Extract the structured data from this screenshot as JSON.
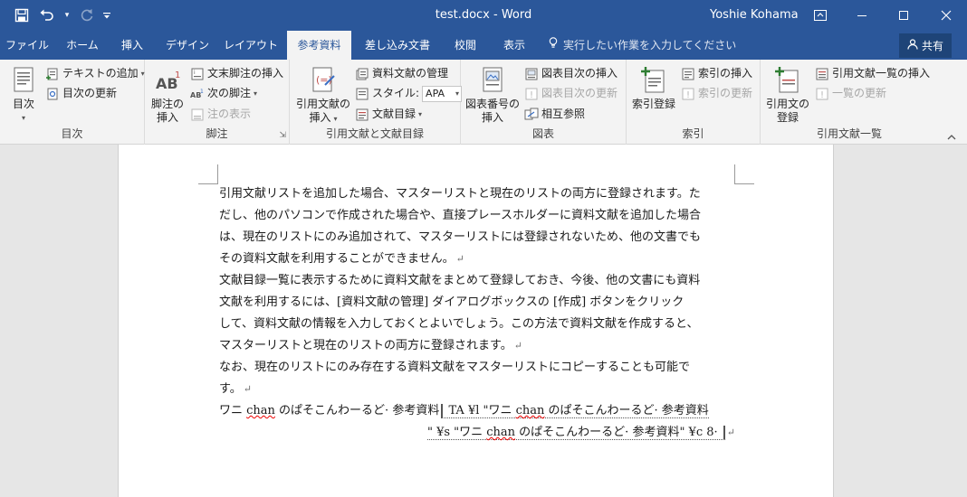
{
  "title_bar": {
    "doc_title": "test.docx - Word",
    "user": "Yoshie Kohama",
    "qat": {
      "save_icon": "save-icon",
      "undo_icon": "undo-icon",
      "redo_icon": "redo-icon",
      "customize_icon": "customize-qat-icon"
    }
  },
  "tabs": [
    {
      "label": "ファイル",
      "active": false
    },
    {
      "label": "ホーム",
      "active": false
    },
    {
      "label": "挿入",
      "active": false
    },
    {
      "label": "デザイン",
      "active": false
    },
    {
      "label": "レイアウト",
      "active": false
    },
    {
      "label": "参考資料",
      "active": true
    },
    {
      "label": "差し込み文書",
      "active": false
    },
    {
      "label": "校閲",
      "active": false
    },
    {
      "label": "表示",
      "active": false
    }
  ],
  "tellme": "実行したい作業を入力してください",
  "share": "共有",
  "ribbon": {
    "toc": {
      "label": "目次",
      "toc_button": "目次",
      "add_text": "テキストの追加",
      "update_toc": "目次の更新"
    },
    "footnotes": {
      "label": "脚注",
      "insert_footnote_l1": "脚注の",
      "insert_footnote_l2": "挿入",
      "insert_endnote": "文末脚注の挿入",
      "next_footnote": "次の脚注",
      "show_notes": "注の表示"
    },
    "citations": {
      "label": "引用文献と文献目録",
      "insert_citation_l1": "引用文献の",
      "insert_citation_l2": "挿入",
      "manage_sources": "資料文献の管理",
      "style_label": "スタイル:",
      "style_value": "APA",
      "bibliography": "文献目録"
    },
    "captions": {
      "label": "図表",
      "insert_caption_l1": "図表番号の",
      "insert_caption_l2": "挿入",
      "insert_tof": "図表目次の挿入",
      "update_table": "図表目次の更新",
      "cross_reference": "相互参照"
    },
    "index": {
      "label": "索引",
      "mark_entry": "索引登録",
      "insert_index": "索引の挿入",
      "update_index": "索引の更新"
    },
    "toa": {
      "label": "引用文献一覧",
      "mark_citation_l1": "引用文の",
      "mark_citation_l2": "登録",
      "insert_toa": "引用文献一覧の挿入",
      "update_toa": "一覧の更新"
    }
  },
  "document": {
    "p1_l1": "引用文献リストを追加した場合、マスターリストと現在のリストの両方に登録されます。た",
    "p1_l2": "だし、他のパソコンで作成された場合や、直接プレースホルダーに資料文献を追加した場合",
    "p1_l3": "は、現在のリストにのみ追加されて、マスターリストには登録されないため、他の文書でも",
    "p1_l4": "その資料文献を利用することができません。",
    "p2_l1": "文献目録一覧に表示するために資料文献をまとめて登録しておき、今後、他の文書にも資料",
    "p2_l2": "文献を利用するには、[資料文献の管理] ダイアログボックスの [作成] ボタンをクリック",
    "p2_l3": "して、資料文献の情報を入力しておくとよいでしょう。この方法で資料文献を作成すると、",
    "p2_l4": "マスターリストと現在のリストの両方に登録されます。",
    "p3_l1": "なお、現在のリストにのみ存在する資料文献をマスターリストにコピーすることも可能で",
    "p3_l2": "す。",
    "f_pre1": "ワニ ",
    "f_chan1": "chan",
    "f_pre2": " のぱそこんわーるど· 参考資料",
    "f_code1": " TA ¥l \"ワニ ",
    "f_chan2": "chan",
    "f_code2": " のぱそこんわーるど· 参考資料",
    "f_code3": "\" ¥s \"ワニ ",
    "f_chan3": "chan",
    "f_code4": " のぱそこんわーるど· 参考資料\" ¥c 8· ",
    "para_mark": "↵"
  }
}
